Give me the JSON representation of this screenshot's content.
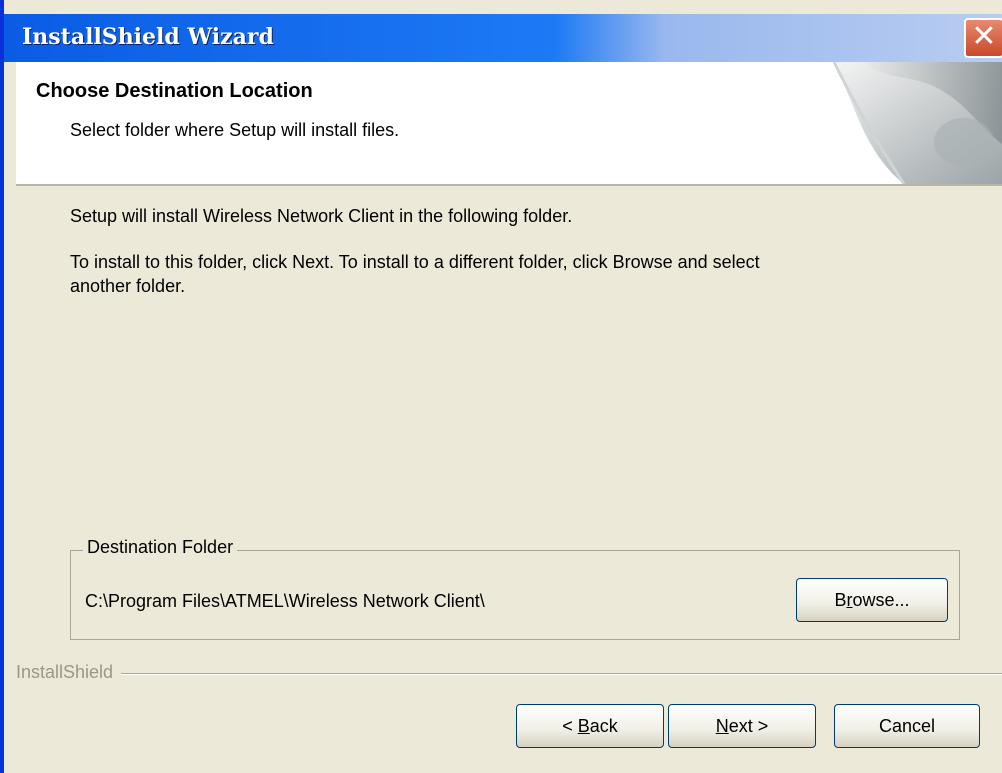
{
  "window": {
    "title": "InstallShield Wizard",
    "close_symbol": "✕"
  },
  "header": {
    "heading": "Choose Destination Location",
    "subheading": "Select folder where Setup will install files."
  },
  "body": {
    "line1": "Setup will install Wireless Network Client in the following folder.",
    "line2": "To install to this folder, click Next. To install to a different folder, click Browse and select",
    "line3": "another folder."
  },
  "destination": {
    "group_label": "Destination Folder",
    "path": "C:\\Program Files\\ATMEL\\Wireless Network Client\\",
    "browse_pre": "B",
    "browse_key": "r",
    "browse_post": "owse..."
  },
  "footer": {
    "brand": "InstallShield",
    "back_pre": "< ",
    "back_key": "B",
    "back_post": "ack",
    "next_key": "N",
    "next_post": "ext >",
    "cancel": "Cancel"
  },
  "colors": {
    "titlebar_start": "#0a5ce4",
    "titlebar_end": "#b9cdf0",
    "dialog_bg": "#ece9d8",
    "close_button": "#c94a2a"
  },
  "icons": {
    "close": "close-icon",
    "header_graphic": "page-curl-icon"
  }
}
